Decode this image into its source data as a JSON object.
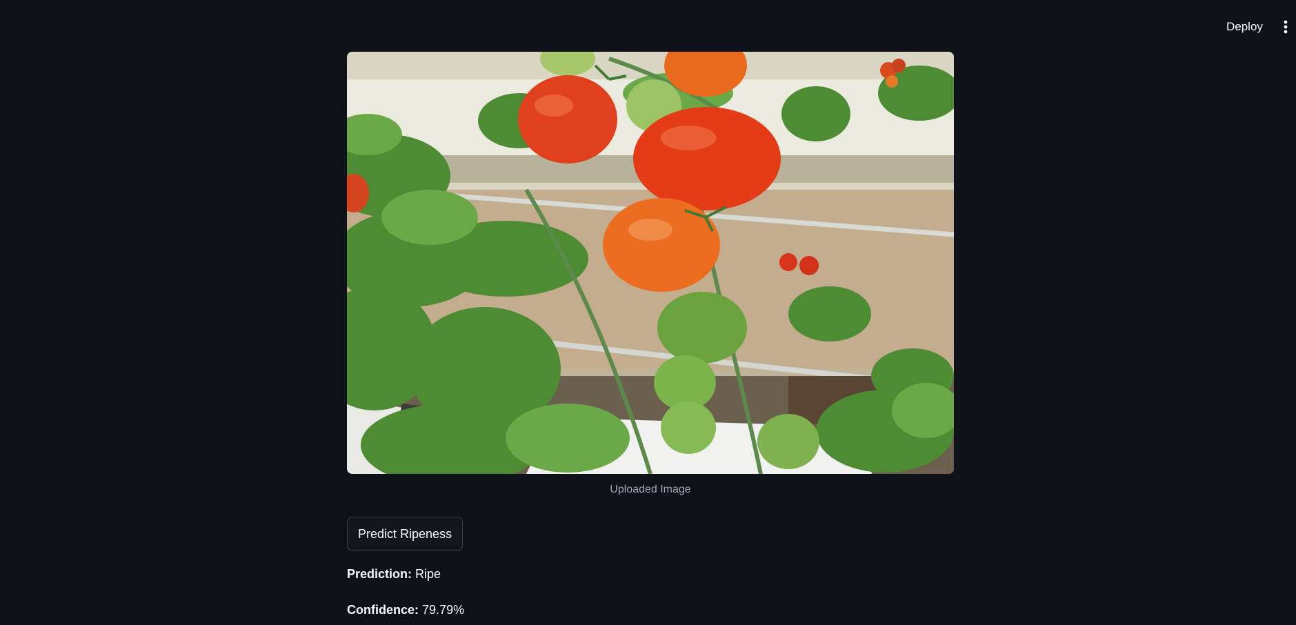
{
  "header": {
    "deploy_label": "Deploy",
    "menu_icon": "vertical-dots-icon"
  },
  "image": {
    "caption": "Uploaded Image"
  },
  "actions": {
    "predict_label": "Predict Ripeness"
  },
  "results": {
    "prediction_label": "Prediction:",
    "prediction_value": "Ripe",
    "confidence_label": "Confidence:",
    "confidence_value": "79.79%"
  },
  "colors": {
    "background": "#0e1117",
    "text": "#fafafa",
    "caption": "#a3a8b8",
    "button_border": "#3b3e48"
  }
}
